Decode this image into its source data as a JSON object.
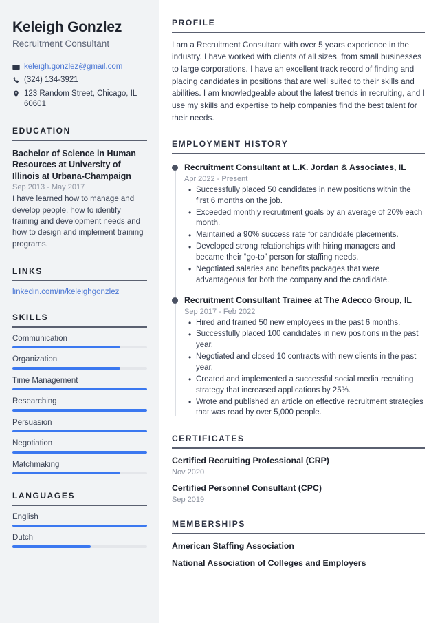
{
  "header": {
    "name": "Keleigh Gonzlez",
    "job_title": "Recruitment Consultant",
    "contacts": [
      {
        "icon": "envelope-icon",
        "text": "keleigh.gonzlez@gmail.com",
        "is_link": true
      },
      {
        "icon": "phone-icon",
        "text": "(324) 134-3921",
        "is_link": false
      },
      {
        "icon": "map-pin-icon",
        "text": "123 Random Street, Chicago, IL 60601",
        "is_link": false
      }
    ]
  },
  "sidebar": {
    "education": {
      "heading": "EDUCATION",
      "entries": [
        {
          "title": "Bachelor of Science in Human Resources at University of Illinois at Urbana-Champaign",
          "date": "Sep 2013 - May 2017",
          "description": "I have learned how to manage and develop people, how to identify training and development needs and how to design and implement training programs."
        }
      ]
    },
    "links": {
      "heading": "LINKS",
      "items": [
        {
          "label": "linkedin.com/in/keleighgonzlez"
        }
      ]
    },
    "skills": {
      "heading": "SKILLS",
      "items": [
        {
          "label": "Communication",
          "level": 80
        },
        {
          "label": "Organization",
          "level": 80
        },
        {
          "label": "Time Management",
          "level": 100
        },
        {
          "label": "Researching",
          "level": 100
        },
        {
          "label": "Persuasion",
          "level": 100
        },
        {
          "label": "Negotiation",
          "level": 100
        },
        {
          "label": "Matchmaking",
          "level": 80
        }
      ]
    },
    "languages": {
      "heading": "LANGUAGES",
      "items": [
        {
          "label": "English",
          "level": 100
        },
        {
          "label": "Dutch",
          "level": 58
        }
      ]
    }
  },
  "main": {
    "profile": {
      "heading": "PROFILE",
      "text": "I am a Recruitment Consultant with over 5 years experience in the industry. I have worked with clients of all sizes, from small businesses to large corporations. I have an excellent track record of finding and placing candidates in positions that are well suited to their skills and abilities. I am knowledgeable about the latest trends in recruiting, and I use my skills and expertise to help companies find the best talent for their needs."
    },
    "employment": {
      "heading": "EMPLOYMENT HISTORY",
      "jobs": [
        {
          "title": "Recruitment Consultant at L.K. Jordan & Associates, IL",
          "date": "Apr 2022 - Present",
          "bullets": [
            "Successfully placed 50 candidates in new positions within the first 6 months on the job.",
            "Exceeded monthly recruitment goals by an average of 20% each month.",
            "Maintained a 90% success rate for candidate placements.",
            "Developed strong relationships with hiring managers and became their “go-to” person for staffing needs.",
            "Negotiated salaries and benefits packages that were advantageous for both the company and the candidate."
          ]
        },
        {
          "title": "Recruitment Consultant Trainee at The Adecco Group, IL",
          "date": "Sep 2017 - Feb 2022",
          "bullets": [
            "Hired and trained 50 new employees in the past 6 months.",
            "Successfully placed 100 candidates in new positions in the past year.",
            "Negotiated and closed 10 contracts with new clients in the past year.",
            "Created and implemented a successful social media recruiting strategy that increased applications by 25%.",
            "Wrote and published an article on effective recruitment strategies that was read by over 5,000 people."
          ]
        }
      ]
    },
    "certificates": {
      "heading": "CERTIFICATES",
      "items": [
        {
          "title": "Certified Recruiting Professional (CRP)",
          "date": "Nov 2020"
        },
        {
          "title": "Certified Personnel Consultant (CPC)",
          "date": "Sep 2019"
        }
      ]
    },
    "memberships": {
      "heading": "MEMBERSHIPS",
      "items": [
        {
          "label": "American Staffing Association"
        },
        {
          "label": "National Association of Colleges and Employers"
        }
      ]
    }
  },
  "theme": {
    "accent": "#3b78f0",
    "link": "#4a76d4",
    "sidebar_bg": "#f1f3f5",
    "heading": "#20242e",
    "muted": "#8a909e"
  }
}
